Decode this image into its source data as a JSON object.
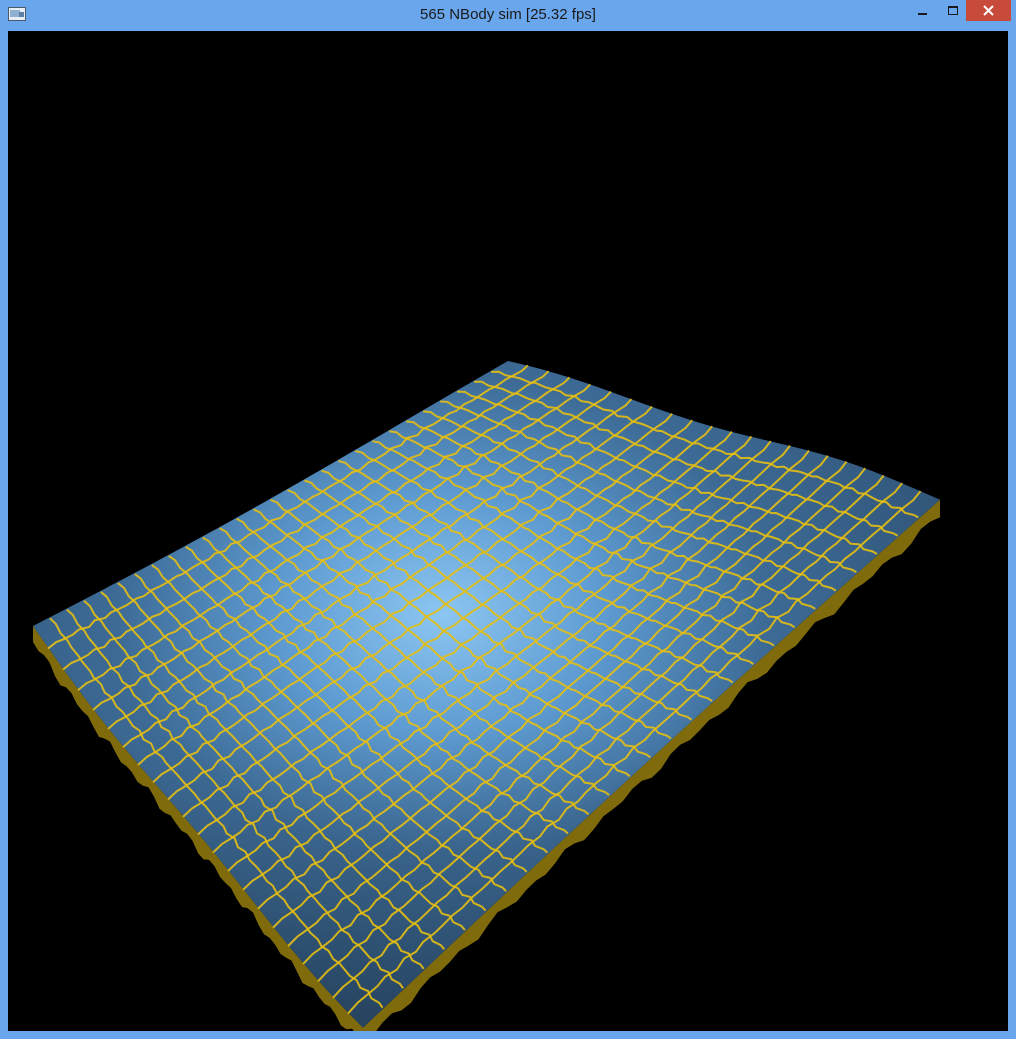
{
  "window": {
    "title": "565 NBody sim [25.32 fps]",
    "app_icon": "opengl-app-icon",
    "controls": [
      "minimize-icon",
      "maximize-icon",
      "close-icon"
    ]
  },
  "viewport": {
    "background": "#000000",
    "surface_colors": {
      "fill_light": "#7db8ea",
      "fill_mid": "#4a87be",
      "fill_dark": "#2f5274",
      "grid": "#e6bf12",
      "edge": "#7f6b0c"
    }
  }
}
